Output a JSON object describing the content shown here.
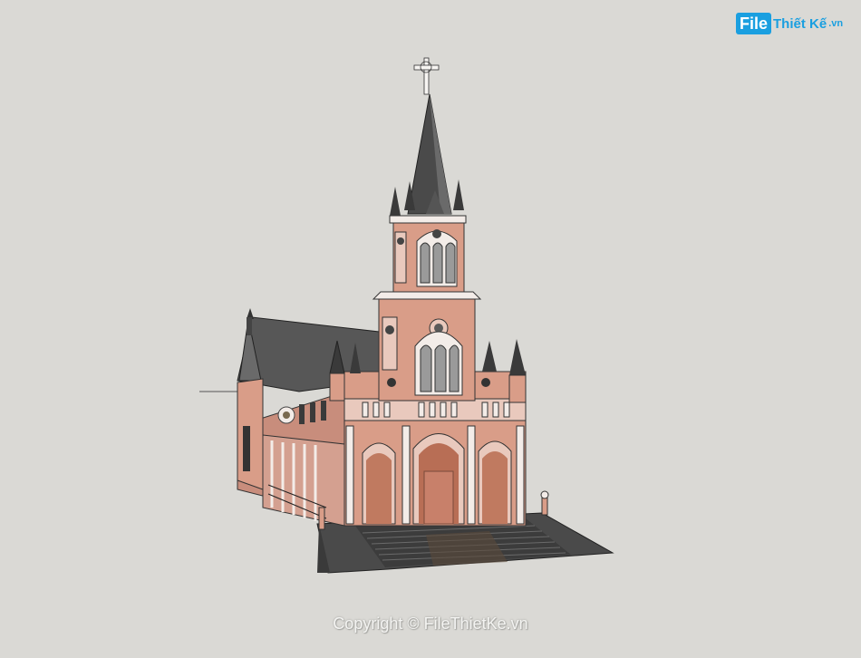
{
  "logo": {
    "file": "File",
    "rest": "Thiết Kế",
    "vn": ".vn"
  },
  "copyright": "Copyright © FileThietKe.vn",
  "colors": {
    "background": "#dad9d5",
    "wall": "#d99d88",
    "trim": "#f3ece8",
    "roof": "#555555",
    "dark": "#2e2e2e",
    "logo": "#1a9fe0"
  }
}
